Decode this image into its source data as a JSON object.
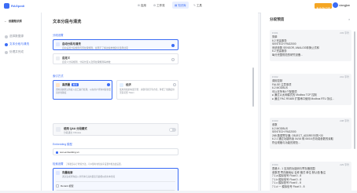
{
  "app": {
    "name": "RAGpedi"
  },
  "nav": {
    "items": [
      {
        "label": "应用"
      },
      {
        "label": "工作流"
      },
      {
        "label": "知识库"
      },
      {
        "label": "工具"
      }
    ]
  },
  "user": {
    "plan": "专业版订阅",
    "name": "xiangjian"
  },
  "sidebar": {
    "back": "创建知识库",
    "steps": [
      {
        "label": "选择数据源"
      },
      {
        "label": "文本分段与清洗"
      },
      {
        "label": "处理并完成"
      }
    ]
  },
  "main": {
    "title": "文本分段与清洗",
    "seg_label": "分段设置",
    "opt_auto_title": "自动分段与清洗",
    "opt_auto_desc": "自动设置分段规则与预处理规则，如果不了解这些参数建议选择此项",
    "opt_custom_title": "自定义",
    "opt_custom_desc": "自定义分段规则、分段长度以及预处理规则等参数",
    "index_label": "索引方式",
    "hq_title": "高质量",
    "hq_tag": "推荐",
    "hq_desc": "调用系统默认的嵌入接口进行处理，以在用户查询时提供更高的准确度",
    "eco_title": "经济",
    "eco_desc": "使用离线的向量引擎、关键词索引等方式，降低了准确度但无需花费 Token",
    "qa_title": "使用 Q&A 分段模式",
    "qa_desc": "分段语言 Chinese",
    "embed_label": "Embedding 模型",
    "embed_value": "text-embedding-v1",
    "retrieval_label": "检索设置",
    "retrieval_hint": "了解更多关于检索方法，可以随时在知识库设置中更改此设置。",
    "vector_title": "向量检索",
    "vector_desc": "通过生成查询嵌入并查询与其向量表示最相似的文本分段",
    "rerank_label": "Rerank 模型"
  },
  "preview": {
    "title": "分段预览",
    "blocks": [
      {
        "id": "# 001",
        "count": "233 字符",
        "lines": [
          "简单",
          "6.2 完善服务",
          "SENTECH PAD2000",
          "系统参数 SENSOR, ANALOG转换公式和",
          "6.2 完善服务",
          "每分完整规范的研究设备..."
        ]
      },
      {
        "id": "# 002",
        "count": "241 字符",
        "lines": [
          "调用控制",
          "FALSE 注意事项",
          "6.2 MODBUS",
          "可以在所有4个配置项",
          "● 通过以太网模式的 Modbus TCP 控制",
          "● 通过 PAC RS485 扩展串口使用 Modbus RTU 协议..."
        ]
      },
      {
        "id": "# 003",
        "count": "238 字符",
        "lines": [
          "参数",
          "6.2 MODBUS",
          "SENTECH PAD2000",
          "26B 数据寄存器, OBJECT_ADDRESS的+33",
          "6.2.1 通过功能码读 04/16 和 06/16 的功能参数的读取",
          "符合规格与功能的规范..."
        ]
      },
      {
        "id": "# 004",
        "count": "229 字符",
        "lines": [
          "表格 8 - 1 支持的功能码与寄存器范围",
          "参数项 寄存器地址 名称 格式 单位 默认值 备注",
          "7.1.a 模拟信号 Float 0 - 8",
          "7.1.b 模拟信号 Float 0 - 8",
          "7.1.c 模拟信号 Float 0 - 8",
          "7.1.d 一 模拟信号 Float 0 - 8"
        ]
      }
    ]
  },
  "colors": {
    "accent": "#3b6cf5",
    "plan_badge": "#f5a623",
    "background": "#f3f4f7"
  }
}
